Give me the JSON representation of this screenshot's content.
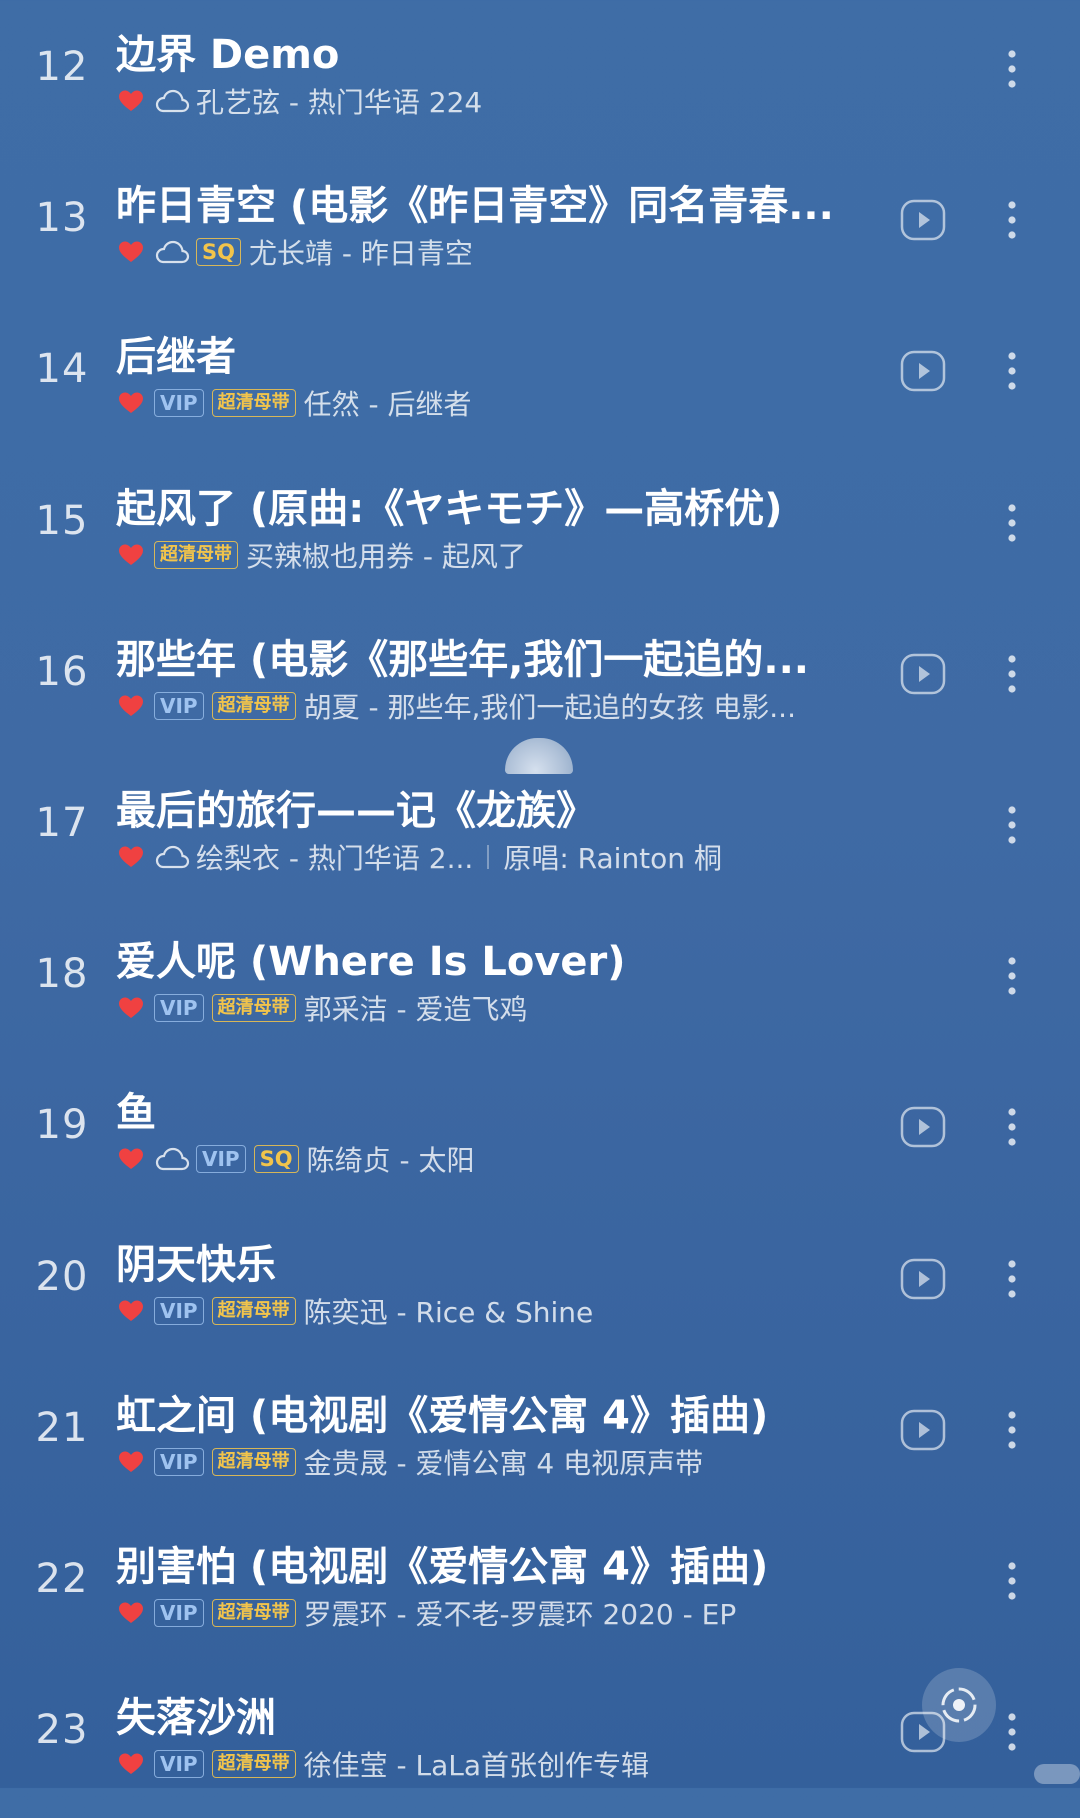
{
  "songs": [
    {
      "num": "12",
      "title": "边界 Demo",
      "heart": true,
      "cloud": true,
      "badges": [],
      "subtitle": "孔艺弦 - 热门华语 224",
      "extra": "",
      "play": false
    },
    {
      "num": "13",
      "title": "昨日青空 (电影《昨日青空》同名青春...",
      "heart": true,
      "cloud": true,
      "badges": [
        "SQ"
      ],
      "subtitle": "尤长靖 - 昨日青空",
      "extra": "",
      "play": true
    },
    {
      "num": "14",
      "title": "后继者",
      "heart": true,
      "cloud": false,
      "badges": [
        "VIP",
        "超清母带"
      ],
      "subtitle": "任然 - 后继者",
      "extra": "",
      "play": true
    },
    {
      "num": "15",
      "title": "起风了 (原曲:《ヤキモチ》—高桥优)",
      "heart": true,
      "cloud": false,
      "badges": [
        "超清母带"
      ],
      "subtitle": "买辣椒也用券 - 起风了",
      "extra": "",
      "play": false
    },
    {
      "num": "16",
      "title": "那些年 (电影《那些年,我们一起追的...",
      "heart": true,
      "cloud": false,
      "badges": [
        "VIP",
        "超清母带"
      ],
      "subtitle": "胡夏 - 那些年,我们一起追的女孩 电影...",
      "extra": "",
      "play": true
    },
    {
      "num": "17",
      "title": "最后的旅行——记《龙族》",
      "heart": true,
      "cloud": true,
      "badges": [],
      "subtitle": "绘梨衣 - 热门华语 2...",
      "extra": "原唱: Rainton 桐",
      "play": false
    },
    {
      "num": "18",
      "title": "爱人呢 (Where Is Lover)",
      "heart": true,
      "cloud": false,
      "badges": [
        "VIP",
        "超清母带"
      ],
      "subtitle": "郭采洁 - 爱造飞鸡",
      "extra": "",
      "play": false
    },
    {
      "num": "19",
      "title": "鱼",
      "heart": true,
      "cloud": true,
      "badges": [
        "VIP",
        "SQ"
      ],
      "subtitle": "陈绮贞 - 太阳",
      "extra": "",
      "play": true
    },
    {
      "num": "20",
      "title": "阴天快乐",
      "heart": true,
      "cloud": false,
      "badges": [
        "VIP",
        "超清母带"
      ],
      "subtitle": "陈奕迅 - Rice & Shine",
      "extra": "",
      "play": true
    },
    {
      "num": "21",
      "title": "虹之间 (电视剧《爱情公寓 4》插曲)",
      "heart": true,
      "cloud": false,
      "badges": [
        "VIP",
        "超清母带"
      ],
      "subtitle": "金贵晟 - 爱情公寓 4 电视原声带",
      "extra": "",
      "play": true
    },
    {
      "num": "22",
      "title": "别害怕 (电视剧《爱情公寓 4》插曲)",
      "heart": true,
      "cloud": false,
      "badges": [
        "VIP",
        "超清母带"
      ],
      "subtitle": "罗震环 - 爱不老-罗震环 2020 - EP",
      "extra": "",
      "play": false
    },
    {
      "num": "23",
      "title": "失落沙洲",
      "heart": true,
      "cloud": false,
      "badges": [
        "VIP",
        "超清母带"
      ],
      "subtitle": "徐佳莹 - LaLa首张创作专辑",
      "extra": "",
      "play": true
    }
  ],
  "icons": {
    "heart": "heart-icon",
    "cloud": "cloud-icon",
    "play": "play-mv-icon",
    "more": "more-vertical-icon",
    "float": "float-recognize-icon"
  },
  "colors": {
    "heart": "#f04141",
    "badge_vip": "#9fc3f0",
    "badge_gold": "#f2c44b"
  }
}
